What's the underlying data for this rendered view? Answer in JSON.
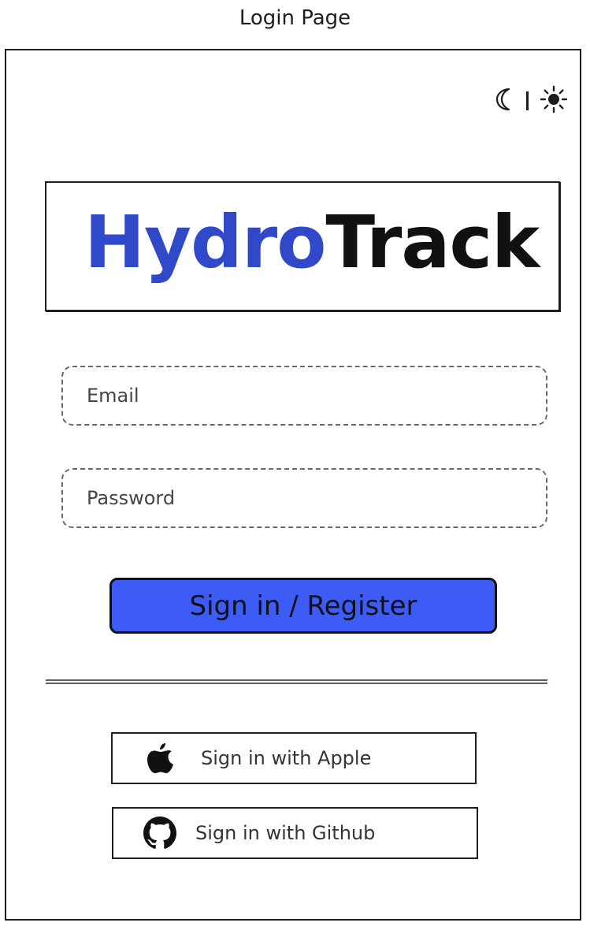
{
  "caption": "Login Page",
  "theme_toggle": {
    "dark_icon": "moon-icon",
    "light_icon": "sun-icon"
  },
  "logo": {
    "part1": "Hydro",
    "part2": "Track",
    "part1_color": "#2f49c9",
    "part2_color": "#111111"
  },
  "form": {
    "email_placeholder": "Email",
    "password_placeholder": "Password",
    "submit_label": "Sign in / Register",
    "submit_color": "#3d5bf5"
  },
  "social": {
    "apple": {
      "label": "Sign in with Apple",
      "icon": "apple-icon"
    },
    "github": {
      "label": "Sign in with Github",
      "icon": "github-icon"
    }
  }
}
